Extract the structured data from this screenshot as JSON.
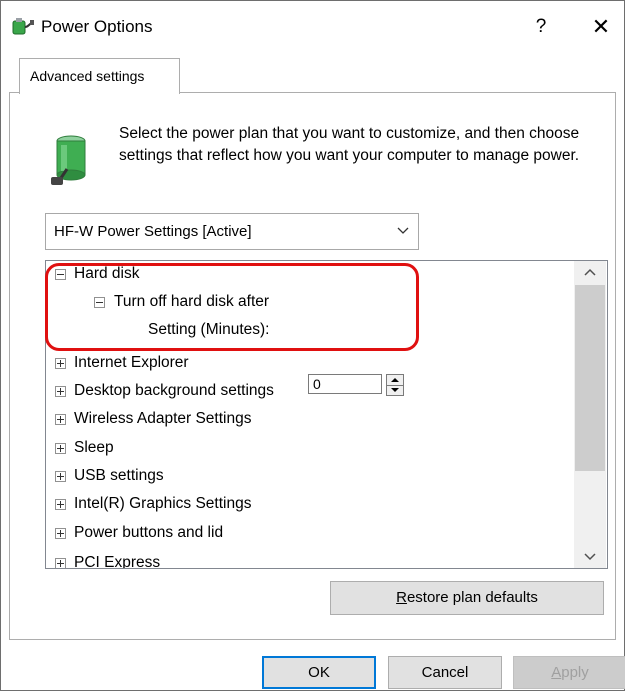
{
  "window": {
    "title": "Power Options",
    "help_glyph": "?",
    "close_glyph": "✕"
  },
  "tabs": [
    {
      "label": "Advanced settings",
      "selected": true
    }
  ],
  "intro": {
    "text": "Select the power plan that you want to customize, and then choose settings that reflect how you want your computer to manage power."
  },
  "plan_select": {
    "value": "HF-W Power Settings [Active]"
  },
  "tree": {
    "items": [
      {
        "label": "Hard disk",
        "expanded": true
      },
      {
        "label": "Turn off hard disk after",
        "expanded": true
      },
      {
        "label": "Setting (Minutes):",
        "value": "0"
      },
      {
        "label": "Internet Explorer",
        "expanded": false
      },
      {
        "label": "Desktop background settings",
        "expanded": false
      },
      {
        "label": "Wireless Adapter Settings",
        "expanded": false
      },
      {
        "label": "Sleep",
        "expanded": false
      },
      {
        "label": "USB settings",
        "expanded": false
      },
      {
        "label": "Intel(R) Graphics Settings",
        "expanded": false
      },
      {
        "label": "Power buttons and lid",
        "expanded": false
      },
      {
        "label": "PCI Express",
        "expanded": false
      }
    ]
  },
  "buttons": {
    "restore_label_prefix": "R",
    "restore_label_rest": "estore plan defaults",
    "ok": "OK",
    "cancel": "Cancel",
    "apply_prefix": "A",
    "apply_rest": "pply"
  },
  "colors": {
    "highlight": "#e01010",
    "default_button_border": "#0078d7"
  }
}
